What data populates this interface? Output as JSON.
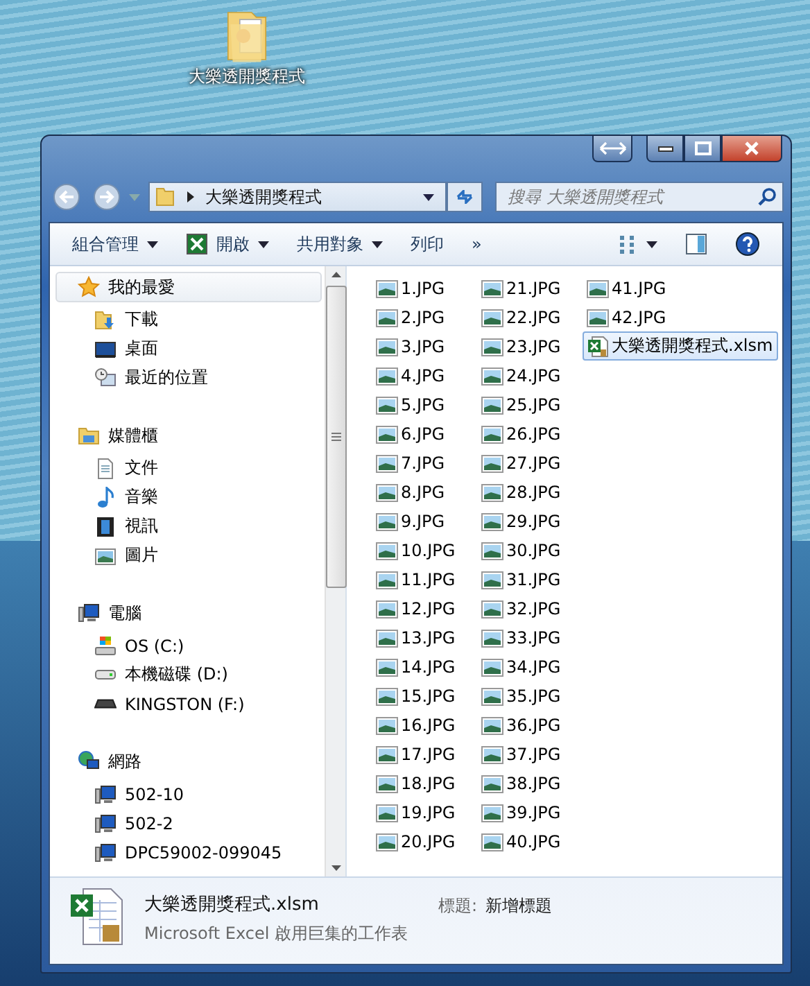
{
  "desktop_icon": {
    "label": "大樂透開獎程式"
  },
  "address": {
    "path": "大樂透開獎程式"
  },
  "search": {
    "placeholder": "搜尋 大樂透開獎程式"
  },
  "toolbar": [
    {
      "label": "組合管理",
      "kind": "menu"
    },
    {
      "label": "開啟",
      "kind": "excel-menu"
    },
    {
      "label": "共用對象",
      "kind": "menu"
    },
    {
      "label": "列印",
      "kind": "plain"
    },
    {
      "label": "»",
      "kind": "plain"
    }
  ],
  "nav": [
    {
      "label": "我的最愛",
      "kind": "star",
      "selected": true,
      "children": [
        {
          "label": "下載",
          "kind": "download"
        },
        {
          "label": "桌面",
          "kind": "desktop"
        },
        {
          "label": "最近的位置",
          "kind": "recent"
        }
      ]
    },
    {
      "label": "媒體櫃",
      "kind": "library",
      "selected": false,
      "children": [
        {
          "label": "文件",
          "kind": "document"
        },
        {
          "label": "音樂",
          "kind": "music"
        },
        {
          "label": "視訊",
          "kind": "video"
        },
        {
          "label": "圖片",
          "kind": "picture"
        }
      ]
    },
    {
      "label": "電腦",
      "kind": "computer",
      "selected": false,
      "children": [
        {
          "label": "OS (C:)",
          "kind": "os-drive"
        },
        {
          "label": "本機磁碟 (D:)",
          "kind": "drive"
        },
        {
          "label": "KINGSTON (F:)",
          "kind": "usb"
        }
      ]
    },
    {
      "label": "網路",
      "kind": "network",
      "selected": false,
      "children": [
        {
          "label": "502-10",
          "kind": "computer"
        },
        {
          "label": "502-2",
          "kind": "computer"
        },
        {
          "label": "DPC59002-099045",
          "kind": "computer"
        }
      ]
    }
  ],
  "files": [
    {
      "name": "1.JPG",
      "kind": "image",
      "selected": false
    },
    {
      "name": "2.JPG",
      "kind": "image",
      "selected": false
    },
    {
      "name": "3.JPG",
      "kind": "image",
      "selected": false
    },
    {
      "name": "4.JPG",
      "kind": "image",
      "selected": false
    },
    {
      "name": "5.JPG",
      "kind": "image",
      "selected": false
    },
    {
      "name": "6.JPG",
      "kind": "image",
      "selected": false
    },
    {
      "name": "7.JPG",
      "kind": "image",
      "selected": false
    },
    {
      "name": "8.JPG",
      "kind": "image",
      "selected": false
    },
    {
      "name": "9.JPG",
      "kind": "image",
      "selected": false
    },
    {
      "name": "10.JPG",
      "kind": "image",
      "selected": false
    },
    {
      "name": "11.JPG",
      "kind": "image",
      "selected": false
    },
    {
      "name": "12.JPG",
      "kind": "image",
      "selected": false
    },
    {
      "name": "13.JPG",
      "kind": "image",
      "selected": false
    },
    {
      "name": "14.JPG",
      "kind": "image",
      "selected": false
    },
    {
      "name": "15.JPG",
      "kind": "image",
      "selected": false
    },
    {
      "name": "16.JPG",
      "kind": "image",
      "selected": false
    },
    {
      "name": "17.JPG",
      "kind": "image",
      "selected": false
    },
    {
      "name": "18.JPG",
      "kind": "image",
      "selected": false
    },
    {
      "name": "19.JPG",
      "kind": "image",
      "selected": false
    },
    {
      "name": "20.JPG",
      "kind": "image",
      "selected": false
    },
    {
      "name": "21.JPG",
      "kind": "image",
      "selected": false
    },
    {
      "name": "22.JPG",
      "kind": "image",
      "selected": false
    },
    {
      "name": "23.JPG",
      "kind": "image",
      "selected": false
    },
    {
      "name": "24.JPG",
      "kind": "image",
      "selected": false
    },
    {
      "name": "25.JPG",
      "kind": "image",
      "selected": false
    },
    {
      "name": "26.JPG",
      "kind": "image",
      "selected": false
    },
    {
      "name": "27.JPG",
      "kind": "image",
      "selected": false
    },
    {
      "name": "28.JPG",
      "kind": "image",
      "selected": false
    },
    {
      "name": "29.JPG",
      "kind": "image",
      "selected": false
    },
    {
      "name": "30.JPG",
      "kind": "image",
      "selected": false
    },
    {
      "name": "31.JPG",
      "kind": "image",
      "selected": false
    },
    {
      "name": "32.JPG",
      "kind": "image",
      "selected": false
    },
    {
      "name": "33.JPG",
      "kind": "image",
      "selected": false
    },
    {
      "name": "34.JPG",
      "kind": "image",
      "selected": false
    },
    {
      "name": "35.JPG",
      "kind": "image",
      "selected": false
    },
    {
      "name": "36.JPG",
      "kind": "image",
      "selected": false
    },
    {
      "name": "37.JPG",
      "kind": "image",
      "selected": false
    },
    {
      "name": "38.JPG",
      "kind": "image",
      "selected": false
    },
    {
      "name": "39.JPG",
      "kind": "image",
      "selected": false
    },
    {
      "name": "40.JPG",
      "kind": "image",
      "selected": false
    },
    {
      "name": "41.JPG",
      "kind": "image",
      "selected": false
    },
    {
      "name": "42.JPG",
      "kind": "image",
      "selected": false
    },
    {
      "name": "大樂透開獎程式.xlsm",
      "kind": "excel",
      "selected": true
    }
  ],
  "details": {
    "name": "大樂透開獎程式.xlsm",
    "type": "Microsoft Excel 啟用巨集的工作表",
    "field_label": "標題:",
    "field_value": "新增標題"
  }
}
